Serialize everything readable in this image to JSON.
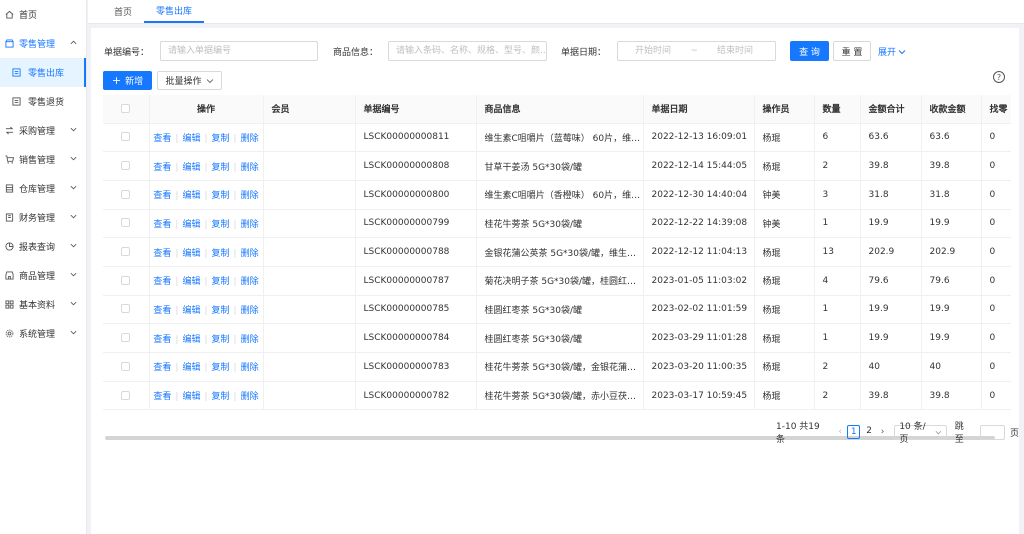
{
  "sidebar": {
    "home": "首页",
    "retail": "零售管理",
    "retail_out": "零售出库",
    "retail_return": "零售退货",
    "purchase": "采购管理",
    "sales": "销售管理",
    "warehouse": "仓库管理",
    "finance": "财务管理",
    "reports": "报表查询",
    "goods": "商品管理",
    "basic": "基本资料",
    "system": "系统管理"
  },
  "tabs": {
    "home": "首页",
    "current": "零售出库"
  },
  "filters": {
    "doc_no_label": "单据编号：",
    "doc_no_placeholder": "请输入单据编号",
    "goods_label": "商品信息：",
    "goods_placeholder": "请输入条码、名称、规格、型号、颜...",
    "date_label": "单据日期：",
    "date_start": "开始时间",
    "date_sep": "~",
    "date_end": "结束时间",
    "query": "查 询",
    "reset": "重 置",
    "expand": "展开"
  },
  "toolbar": {
    "add": "新增",
    "batch": "批量操作"
  },
  "table": {
    "headers": [
      "操作",
      "会员",
      "单据编号",
      "商品信息",
      "单据日期",
      "操作员",
      "数量",
      "金额合计",
      "收款金额",
      "找零"
    ],
    "op_view": "查看",
    "op_edit": "编辑",
    "op_copy": "复制",
    "op_delete": "删除",
    "rows": [
      {
        "member": "",
        "no": "LSCK00000000811",
        "goods": "维生素C咀嚼片（蓝莓味） 60片，维生...",
        "date": "2022-12-13 16:09:01",
        "operator": "杨琨",
        "qty": "6",
        "total": "63.6",
        "paid": "63.6",
        "change": "0"
      },
      {
        "member": "",
        "no": "LSCK00000000808",
        "goods": "甘草干姜汤 5G*30袋/罐",
        "date": "2022-12-14 15:44:05",
        "operator": "杨琨",
        "qty": "2",
        "total": "39.8",
        "paid": "39.8",
        "change": "0"
      },
      {
        "member": "",
        "no": "LSCK00000000800",
        "goods": "维生素C咀嚼片（香橙味） 60片，维生...",
        "date": "2022-12-30 14:40:04",
        "operator": "钟美",
        "qty": "3",
        "total": "31.8",
        "paid": "31.8",
        "change": "0"
      },
      {
        "member": "",
        "no": "LSCK00000000799",
        "goods": "桂花牛蒡茶 5G*30袋/罐",
        "date": "2022-12-22 14:39:08",
        "operator": "钟美",
        "qty": "1",
        "total": "19.9",
        "paid": "19.9",
        "change": "0"
      },
      {
        "member": "",
        "no": "LSCK00000000788",
        "goods": "金银花蒲公英茶 5G*30袋/罐，维生素C...",
        "date": "2022-12-12 11:04:13",
        "operator": "杨琨",
        "qty": "13",
        "total": "202.9",
        "paid": "202.9",
        "change": "0"
      },
      {
        "member": "",
        "no": "LSCK00000000787",
        "goods": "菊花决明子茶 5G*30袋/罐，桂圆红枣...",
        "date": "2023-01-05 11:03:02",
        "operator": "杨琨",
        "qty": "4",
        "total": "79.6",
        "paid": "79.6",
        "change": "0"
      },
      {
        "member": "",
        "no": "LSCK00000000785",
        "goods": "桂圆红枣茶 5G*30袋/罐",
        "date": "2023-02-02 11:01:59",
        "operator": "杨琨",
        "qty": "1",
        "total": "19.9",
        "paid": "19.9",
        "change": "0"
      },
      {
        "member": "",
        "no": "LSCK00000000784",
        "goods": "桂圆红枣茶 5G*30袋/罐",
        "date": "2023-03-29 11:01:28",
        "operator": "杨琨",
        "qty": "1",
        "total": "19.9",
        "paid": "19.9",
        "change": "0"
      },
      {
        "member": "",
        "no": "LSCK00000000783",
        "goods": "桂花牛蒡茶 5G*30袋/罐，金银花蒲公...",
        "date": "2023-03-20 11:00:35",
        "operator": "杨琨",
        "qty": "2",
        "total": "40",
        "paid": "40",
        "change": "0"
      },
      {
        "member": "",
        "no": "LSCK00000000782",
        "goods": "桂花牛蒡茶 5G*30袋/罐，赤小豆茯苓...",
        "date": "2023-03-17 10:59:45",
        "operator": "杨琨",
        "qty": "2",
        "total": "39.8",
        "paid": "39.8",
        "change": "0"
      }
    ]
  },
  "pagination": {
    "total": "1-10 共19条",
    "page1": "1",
    "page2": "2",
    "size": "10 条/页",
    "jump_label": "跳至",
    "page_unit": "页"
  },
  "colors": {
    "primary": "#1677ff",
    "active_bg": "#e6f4ff"
  }
}
